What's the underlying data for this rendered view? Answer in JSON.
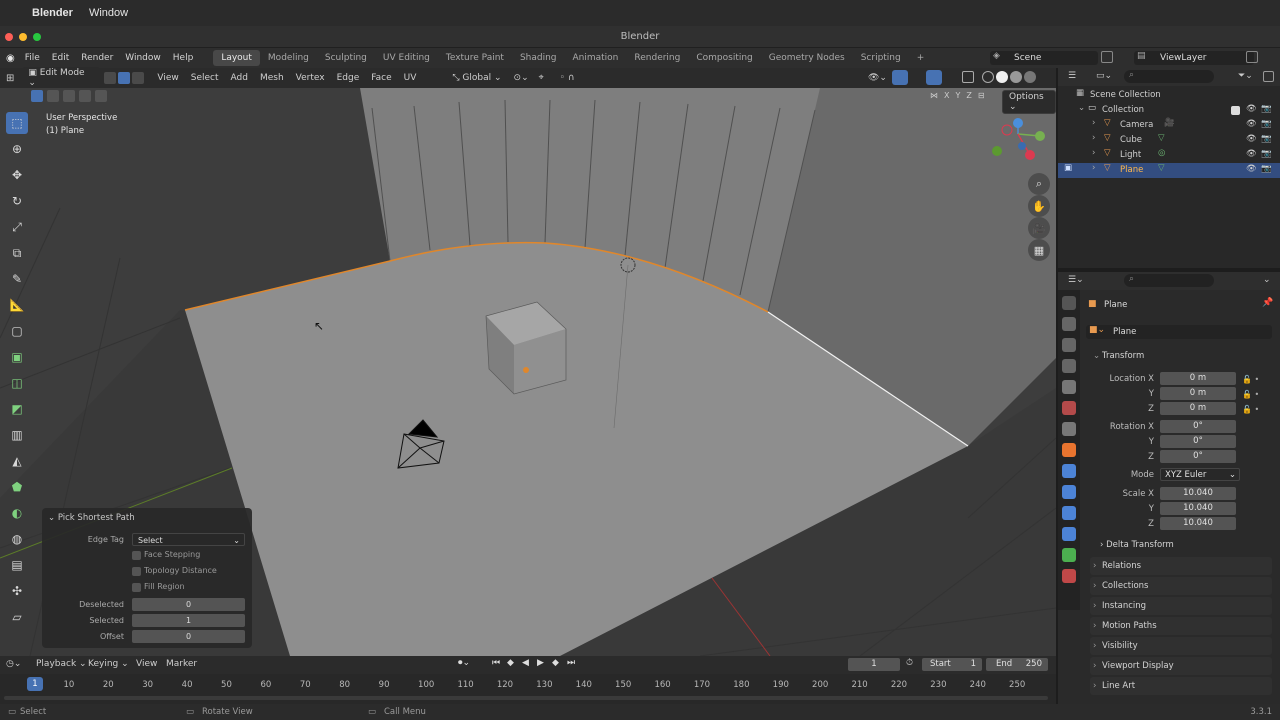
{
  "mac": {
    "app": "Blender",
    "menu": "Window"
  },
  "window_title": "Blender",
  "menus": [
    "File",
    "Edit",
    "Render",
    "Window",
    "Help"
  ],
  "workspaces": [
    "Layout",
    "Modeling",
    "Sculpting",
    "UV Editing",
    "Texture Paint",
    "Shading",
    "Animation",
    "Rendering",
    "Compositing",
    "Geometry Nodes",
    "Scripting"
  ],
  "active_workspace": "Layout",
  "add_workspace": "+",
  "scene": {
    "label": "Scene",
    "view_layer": "ViewLayer"
  },
  "viewport_header": {
    "mode": "Edit Mode",
    "menus": [
      "View",
      "Select",
      "Add",
      "Mesh",
      "Vertex",
      "Edge",
      "Face",
      "UV"
    ],
    "transform_orientation": "Global",
    "axes": [
      "X",
      "Y",
      "Z"
    ],
    "options": "Options"
  },
  "viewport": {
    "perspective": "User Perspective",
    "object": "(1) Plane"
  },
  "redo_panel": {
    "title": "Pick Shortest Path",
    "edge_tag_label": "Edge Tag",
    "edge_tag_value": "Select",
    "face_stepping": "Face Stepping",
    "topology_distance": "Topology Distance",
    "fill_region": "Fill Region",
    "deselected_label": "Deselected",
    "deselected_value": "0",
    "selected_label": "Selected",
    "selected_value": "1",
    "offset_label": "Offset",
    "offset_value": "0"
  },
  "outliner": {
    "root": "Scene Collection",
    "collection": "Collection",
    "items": [
      "Camera",
      "Cube",
      "Light",
      "Plane"
    ],
    "selected": "Plane"
  },
  "properties": {
    "object_name": "Plane",
    "data_name": "Plane",
    "transform": "Transform",
    "location_label": "Location X",
    "location": [
      "0 m",
      "0 m",
      "0 m"
    ],
    "rotation_label": "Rotation X",
    "rotation": [
      "0°",
      "0°",
      "0°"
    ],
    "mode_label": "Mode",
    "mode_value": "XYZ Euler",
    "scale_label": "Scale X",
    "scale": [
      "10.040",
      "10.040",
      "10.040"
    ],
    "y": "Y",
    "z": "Z",
    "delta_transform": "Delta Transform",
    "sections": [
      "Relations",
      "Collections",
      "Instancing",
      "Motion Paths",
      "Visibility",
      "Viewport Display",
      "Line Art"
    ]
  },
  "timeline": {
    "menus": [
      "Playback",
      "Keying",
      "View",
      "Marker"
    ],
    "current_frame": "1",
    "start_label": "Start",
    "start": "1",
    "end_label": "End",
    "end": "250",
    "ticks": [
      "1",
      "10",
      "20",
      "30",
      "40",
      "50",
      "60",
      "70",
      "80",
      "90",
      "100",
      "110",
      "120",
      "130",
      "140",
      "150",
      "160",
      "170",
      "180",
      "190",
      "200",
      "210",
      "220",
      "230",
      "240",
      "250"
    ]
  },
  "status": {
    "select": "Select",
    "rotate": "Rotate View",
    "call_menu": "Call Menu",
    "version": "3.3.1"
  },
  "colors": {
    "accent": "#4772b3",
    "selected_edge": "#e0872b",
    "active_row": "#334d80"
  }
}
